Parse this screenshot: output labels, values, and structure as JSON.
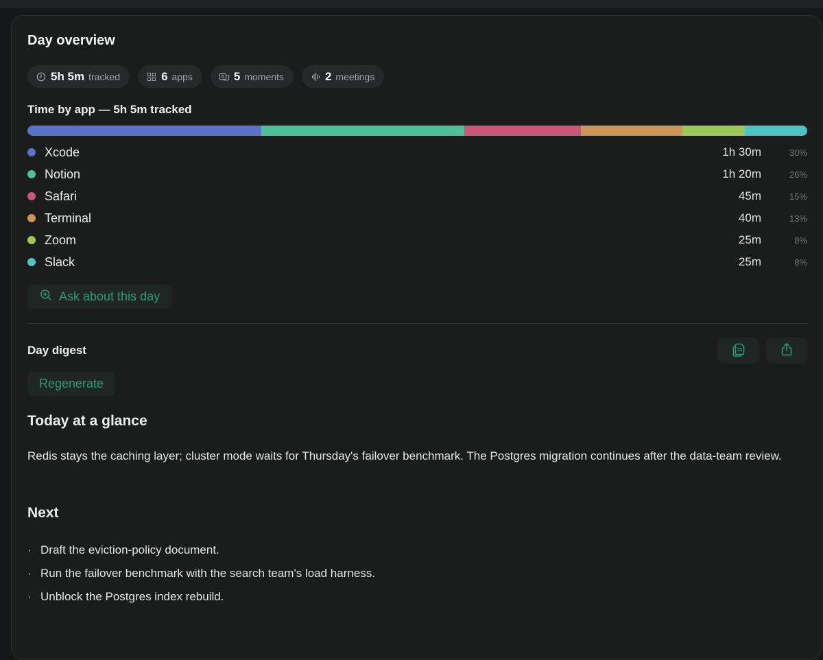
{
  "overview": {
    "title": "Day overview",
    "stats": [
      {
        "icon": "clock-icon",
        "value": "5h 5m",
        "label": "tracked"
      },
      {
        "icon": "grid-icon",
        "value": "6",
        "label": "apps"
      },
      {
        "icon": "moments-icon",
        "value": "5",
        "label": "moments"
      },
      {
        "icon": "audio-wave-icon",
        "value": "2",
        "label": "meetings"
      }
    ]
  },
  "time_by_app": {
    "title": "Time by app — 5h 5m tracked",
    "apps": [
      {
        "name": "Xcode",
        "time": "1h 30m",
        "percent": "30%",
        "share": 30,
        "color": "#5a72c8"
      },
      {
        "name": "Notion",
        "time": "1h 20m",
        "percent": "26%",
        "share": 26,
        "color": "#4fbf9a"
      },
      {
        "name": "Safari",
        "time": "45m",
        "percent": "15%",
        "share": 15,
        "color": "#c9577a"
      },
      {
        "name": "Terminal",
        "time": "40m",
        "percent": "13%",
        "share": 13,
        "color": "#cc9558"
      },
      {
        "name": "Zoom",
        "time": "25m",
        "percent": "8%",
        "share": 8,
        "color": "#9cc657"
      },
      {
        "name": "Slack",
        "time": "25m",
        "percent": "8%",
        "share": 8,
        "color": "#4ec3c3"
      }
    ]
  },
  "ask_label": "Ask about this day",
  "digest": {
    "title": "Day digest",
    "regenerate_label": "Regenerate",
    "glance_title": "Today at a glance",
    "glance_text": "Redis stays the caching layer; cluster mode waits for Thursday's failover benchmark. The Postgres migration continues after the data-team review.",
    "next_title": "Next",
    "next_items": [
      "Draft the eviction-policy document.",
      "Run the failover benchmark with the search team's load harness.",
      "Unblock the Postgres index rebuild."
    ]
  },
  "colors": {
    "accent": "#2c9c7b",
    "card_bg": "#1b1c1c",
    "pill_bg": "#262829"
  }
}
